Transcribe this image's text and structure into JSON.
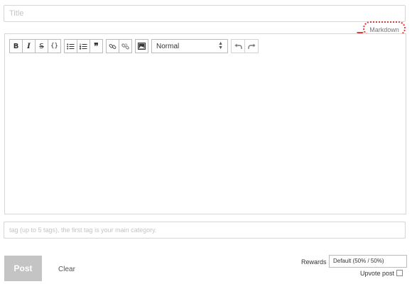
{
  "title_field": {
    "placeholder": "Title",
    "value": ""
  },
  "markdown_link": {
    "label": "Markdown",
    "highlight_color": "#e03a3a"
  },
  "toolbar": {
    "bold_label": "B",
    "italic_label": "I",
    "strike_label": "S",
    "code_label": "{}",
    "quote_label": "❞",
    "format_select_value": "Normal",
    "icons": [
      "bold-icon",
      "italic-icon",
      "strikethrough-icon",
      "code-icon",
      "bullet-list-icon",
      "numbered-list-icon",
      "quote-icon",
      "link-icon",
      "unlink-icon",
      "image-icon",
      "undo-icon",
      "redo-icon"
    ]
  },
  "editor": {
    "body": ""
  },
  "tags_field": {
    "placeholder": "tag (up to 5 tags), the first tag is your main category.",
    "value": ""
  },
  "footer": {
    "post_label": "Post",
    "clear_label": "Clear",
    "rewards_label": "Rewards",
    "rewards_value": "Default (50% / 50%)",
    "upvote_label": "Upvote post",
    "upvote_checked": false
  },
  "colors": {
    "border": "#d6d6d6",
    "post_button_bg": "#c4c4c4",
    "annotation": "#e03a3a"
  }
}
